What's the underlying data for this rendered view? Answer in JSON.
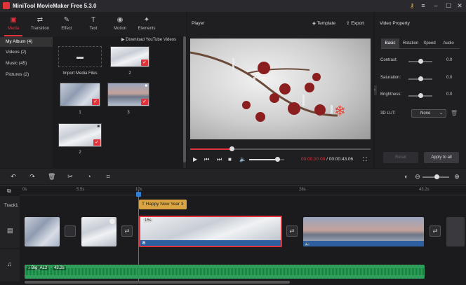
{
  "app": {
    "title": "MiniTool MovieMaker Free 5.3.0"
  },
  "toolbar": {
    "media": "Media",
    "transition": "Transition",
    "effect": "Effect",
    "text": "Text",
    "motion": "Motion",
    "elements": "Elements"
  },
  "sidenav": {
    "my_album": "My Album (4)",
    "videos": "Videos (2)",
    "music": "Music (45)",
    "pictures": "Pictures (2)"
  },
  "media": {
    "download_yt": "Download YouTube Videos",
    "import_label": "Import Media Files",
    "items": [
      {
        "label": "2"
      },
      {
        "label": "1"
      },
      {
        "label": "3"
      },
      {
        "label": "2"
      }
    ]
  },
  "player": {
    "title": "Player",
    "template": "Template",
    "export": "Export",
    "current_time": "00:00:10.00",
    "separator": "/",
    "total_time": "00:00:43.06",
    "progress": 0.23,
    "volume": 0.8
  },
  "property": {
    "title": "Video Property",
    "tabs": [
      "Basic",
      "Rotation",
      "Speed",
      "Audio"
    ],
    "contrast_label": "Contrast:",
    "contrast_value": "0.0",
    "saturation_label": "Saturation:",
    "saturation_value": "0.0",
    "brightness_label": "Brightness:",
    "brightness_value": "0.0",
    "lut_label": "3D LUT:",
    "lut_value": "None",
    "reset": "Reset",
    "apply_all": "Apply to all"
  },
  "timeline": {
    "ruler": [
      "0s",
      "5.5s",
      "10s",
      "28s",
      "43.2s"
    ],
    "track1": "Track1",
    "text_clip": "Happy New Year 3",
    "clip_duration": "15s",
    "audio_name": "Big_AL2",
    "audio_duration": "43.2s"
  },
  "colors": {
    "accent": "#e2323a",
    "text_clip": "#d9a441",
    "audio": "#2f9e5a",
    "selected": "#e2323a"
  }
}
